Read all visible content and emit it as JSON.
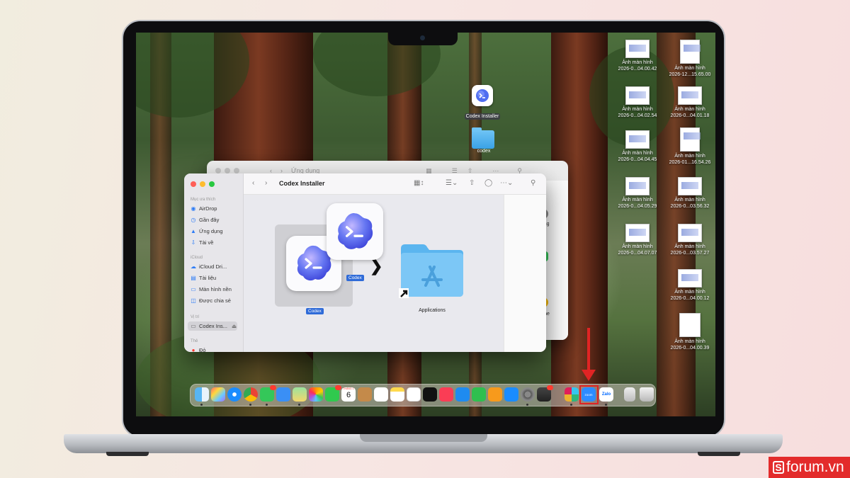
{
  "desktop": {
    "files": [
      {
        "label": "Ảnh màn hình",
        "sub": "2026-0...04.00.42"
      },
      {
        "label": "Ảnh màn hình",
        "sub": "2026-12...15.65.00"
      },
      {
        "label": "Ảnh màn hình",
        "sub": "2026-0...04.02.54"
      },
      {
        "label": "Ảnh màn hình",
        "sub": "2026-0...04.01.18"
      },
      {
        "label": "Ảnh màn hình",
        "sub": "2026-0...04.04.45"
      },
      {
        "label": "Ảnh màn hình",
        "sub": "2026-01...16.54.26"
      },
      {
        "label": "Ảnh màn hình",
        "sub": "2026-0...04.05.29"
      },
      {
        "label": "Ảnh màn hình",
        "sub": "2026-0...03.56.32"
      },
      {
        "label": "Ảnh màn hình",
        "sub": "2026-0...04.07.07"
      },
      {
        "label": "Ảnh màn hình",
        "sub": "2026-0...03.57.27"
      },
      {
        "label": "Ảnh màn hình",
        "sub": "2026-0...04.00.12"
      },
      {
        "label": "Ảnh màn hình",
        "sub": "2026-0...04.00.39"
      }
    ],
    "codex_installer_label": "Codex Installer",
    "folder_label": "codex"
  },
  "back_window": {
    "title": "Ứng dụng",
    "items": [
      "hống",
      "me",
      "rome"
    ]
  },
  "finder": {
    "title": "Codex Installer",
    "sidebar": {
      "favorites_header": "Mục ưa thích",
      "favorites": [
        "AirDrop",
        "Gần đây",
        "Ứng dụng",
        "Tài về"
      ],
      "icloud_header": "iCloud",
      "icloud": [
        "iCloud Dri...",
        "Tài liệu",
        "Màn hình nền",
        "Được chia sẻ"
      ],
      "locations_header": "Vị trí",
      "locations": [
        "Codex Ins..."
      ],
      "tags_header": "Thẻ",
      "tags": [
        "Đỏ"
      ]
    },
    "codex_label": "Codex",
    "drag_label": "Codex",
    "applications_label": "Applications"
  },
  "dock": {
    "calendar_month": "THÁNG 1",
    "calendar_day": "6",
    "zoom_label": "zoom",
    "zalo_label": "Zalo",
    "apps": [
      "finder",
      "launchpad",
      "safari",
      "chrome",
      "messages",
      "mail",
      "maps",
      "photos",
      "facetime",
      "calendar",
      "contacts",
      "reminders",
      "notes",
      "freeform",
      "tv",
      "music",
      "keynote",
      "numbers",
      "pages",
      "app-store",
      "system-settings",
      "iphone-mirroring",
      "slack",
      "zoom",
      "zalo",
      "downloads",
      "trash"
    ]
  },
  "watermark": {
    "text": "forum.vn",
    "letter": "S"
  },
  "colors": {
    "highlight_red": "#e02424",
    "selection_blue": "#2f6bd8",
    "folder_blue": "#5bb5ef"
  }
}
